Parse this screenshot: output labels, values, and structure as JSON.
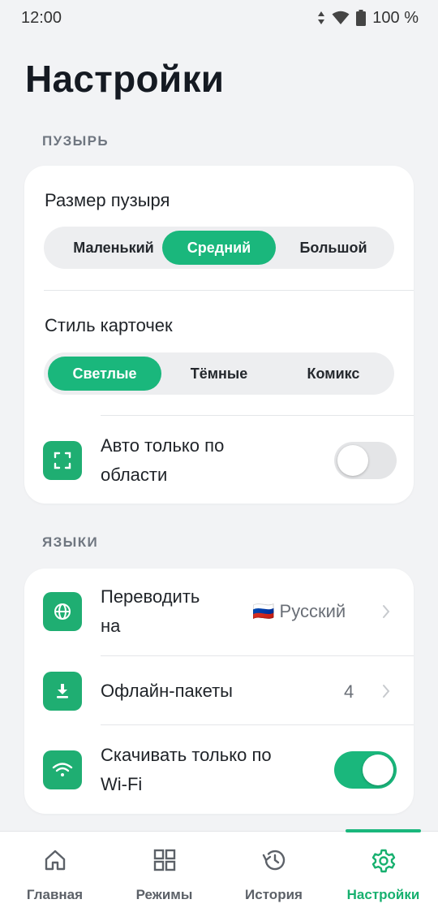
{
  "status_bar": {
    "time": "12:00",
    "battery": "100 %",
    "icons": [
      "data-arrows-icon",
      "wifi-icon",
      "battery-icon"
    ]
  },
  "page": {
    "title": "Настройки"
  },
  "bubble_section": {
    "label": "ПУЗЫРЬ",
    "bubble_size": {
      "heading": "Размер пузыря",
      "options": [
        "Маленький",
        "Средний",
        "Большой"
      ],
      "selected": "Средний"
    },
    "card_style": {
      "heading": "Стиль карточек",
      "options": [
        "Светлые",
        "Тёмные",
        "Комикс"
      ],
      "selected": "Светлые"
    },
    "auto_area": {
      "label_line1": "Авто только по",
      "label_line2": "области",
      "icon": "scan-area-icon",
      "enabled": false
    }
  },
  "languages_section": {
    "label": "ЯЗЫКИ",
    "translate_to": {
      "label_line1": "Переводить",
      "label_line2": "на",
      "flag": "🇷🇺",
      "value": "Русский",
      "icon": "globe-icon"
    },
    "offline_packs": {
      "label": "Офлайн-пакеты",
      "value": "4",
      "icon": "download-icon"
    },
    "wifi_only": {
      "label_line1": "Скачивать только по",
      "label_line2": "Wi-Fi",
      "icon": "wifi-icon",
      "enabled": true
    }
  },
  "tab_bar": {
    "tabs": [
      {
        "label": "Главная",
        "icon": "home-icon"
      },
      {
        "label": "Режимы",
        "icon": "grid-icon"
      },
      {
        "label": "История",
        "icon": "history-icon"
      },
      {
        "label": "Настройки",
        "icon": "gear-icon"
      }
    ],
    "active": "Настройки"
  },
  "colors": {
    "accent": "#1ab77c",
    "background": "#f2f3f5",
    "card": "#ffffff",
    "text": "#151a22",
    "muted": "#6f7680"
  }
}
